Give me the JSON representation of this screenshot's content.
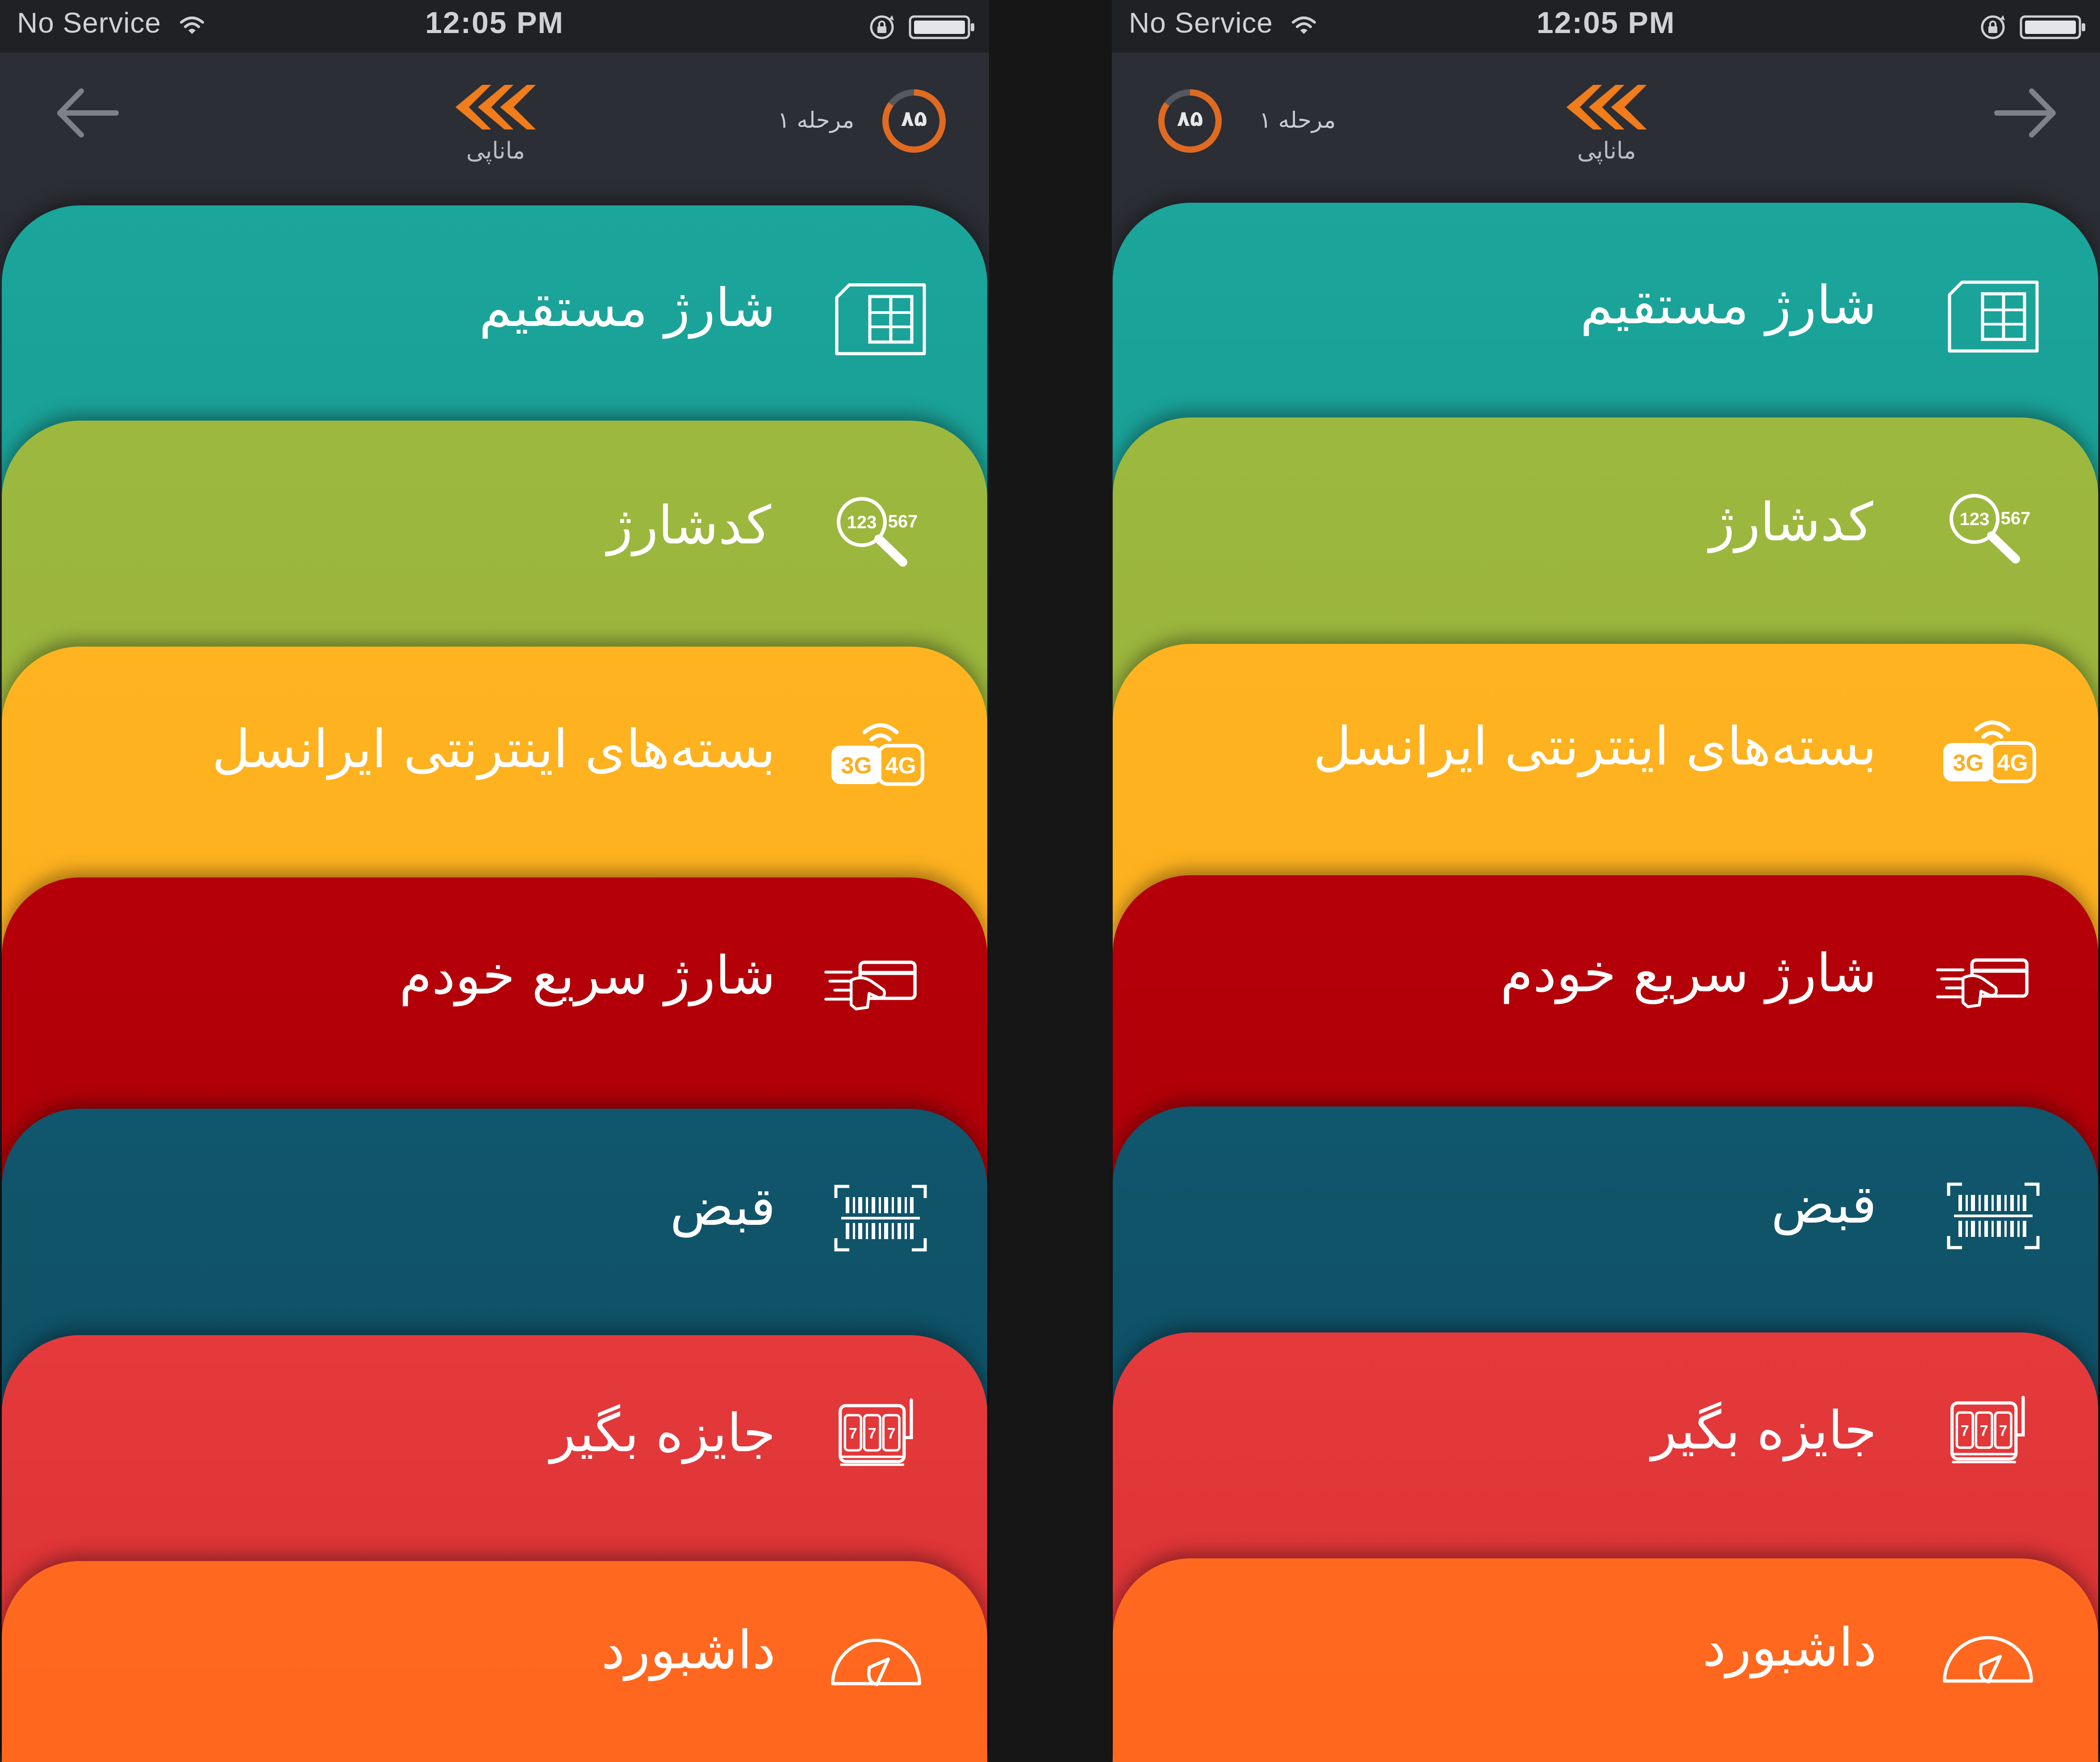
{
  "status_bar": {
    "carrier": "No Service",
    "time": "12:05 PM"
  },
  "header": {
    "logo_text": "ماناپی",
    "stage_label": "مرحله ۱",
    "score": "۸۵",
    "progress": 0.85
  },
  "menu": [
    {
      "label": "شارژ مستقیم",
      "icon": "sim-card-icon",
      "color": "#1aa097"
    },
    {
      "label": "کدشارژ",
      "icon": "code-search-icon",
      "color": "#9bb63c"
    },
    {
      "label": "بسته‌های اینترنتی ایرانسل",
      "icon": "3g-4g-icon",
      "color": "#fdb120"
    },
    {
      "label": "شارژ سریع خودم",
      "icon": "fast-card-icon",
      "color": "#b00007"
    },
    {
      "label": "قبض",
      "icon": "barcode-icon",
      "color": "#0f5368"
    },
    {
      "label": "جایزه بگیر",
      "icon": "slot-machine-icon",
      "color": "#e33638"
    },
    {
      "label": "داشبورد",
      "icon": "speedometer-icon",
      "color": "#ff661e"
    }
  ],
  "colors": {
    "accent": "#f07c1c",
    "status_bar_bg": "#1f2125",
    "nav_bg": "#2b2e34"
  }
}
